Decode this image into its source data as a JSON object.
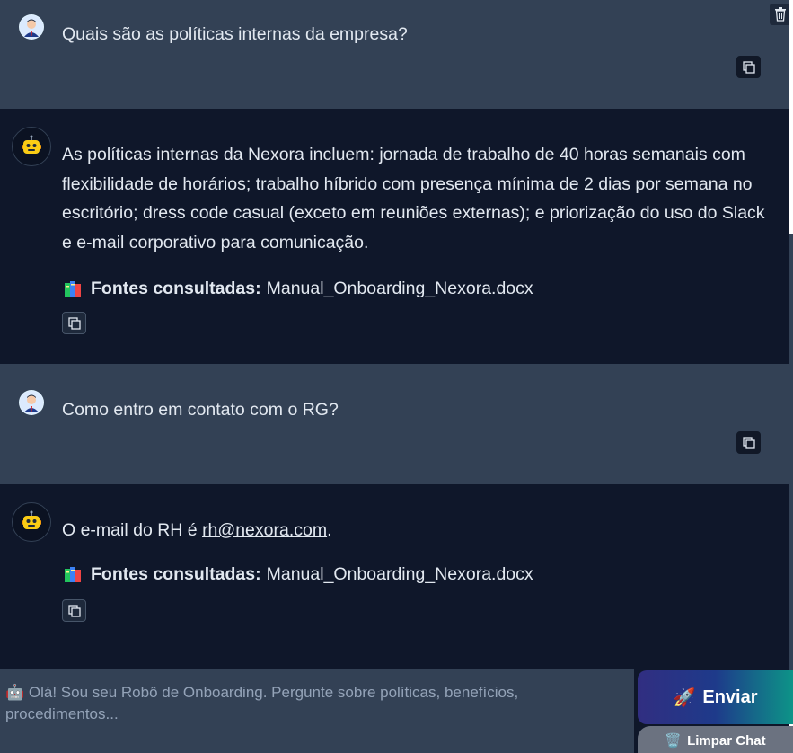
{
  "messages": [
    {
      "role": "user",
      "text": "Quais são as políticas internas da empresa?"
    },
    {
      "role": "bot",
      "text": "As políticas internas da Nexora incluem: jornada de trabalho de 40 horas semanais com flexibilidade de horários; trabalho híbrido com presença mínima de 2 dias por semana no escritório; dress code casual (exceto em reuniões externas); e priorização do uso do Slack e e-mail corporativo para comunicação.",
      "sources_label": "Fontes consultadas:",
      "sources_file": "Manual_Onboarding_Nexora.docx"
    },
    {
      "role": "user",
      "text": "Como entro em contato com o RG?"
    },
    {
      "role": "bot",
      "text_before": "O e-mail do RH é ",
      "email": "rh@nexora.com",
      "text_after": ".",
      "sources_label": "Fontes consultadas:",
      "sources_file": "Manual_Onboarding_Nexora.docx"
    }
  ],
  "input": {
    "placeholder": "🤖 Olá! Sou seu Robô de Onboarding. Pergunte sobre políticas, benefícios, procedimentos..."
  },
  "buttons": {
    "send_label": "Enviar",
    "send_icon": "🚀",
    "clear_label": "Limpar Chat",
    "clear_icon": "🗑️"
  },
  "icons": {
    "user_avatar": "user-avatar-icon",
    "bot_avatar": "robot-icon",
    "copy": "copy-icon",
    "trash": "trash-icon",
    "books": "books-icon"
  },
  "colors": {
    "user_bg": "#334155",
    "bot_bg": "#0f172a",
    "text": "#e2e8f0",
    "send_gradient": [
      "#312e81",
      "#0d9488"
    ],
    "clear_bg": "#6b7280"
  }
}
